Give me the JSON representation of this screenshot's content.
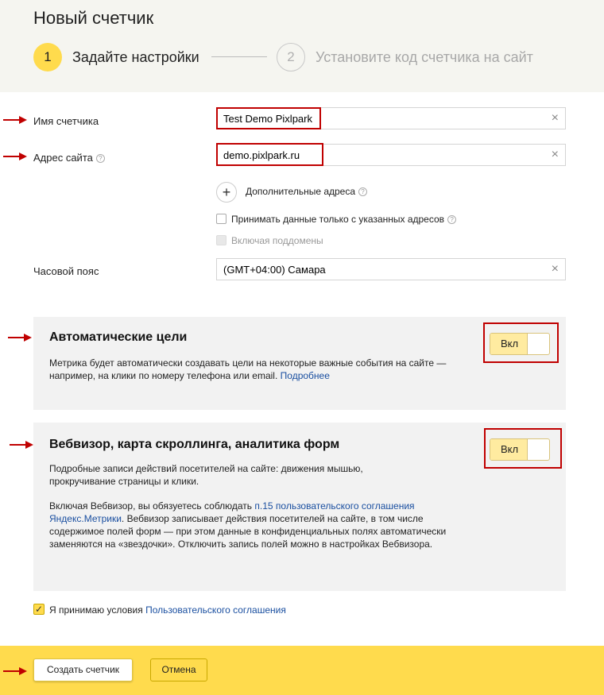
{
  "header": {
    "title": "Новый счетчик",
    "step1_number": "1",
    "step1_label": "Задайте настройки",
    "step2_number": "2",
    "step2_label": "Установите код счетчика на сайт"
  },
  "form": {
    "counter_name_label": "Имя счетчика",
    "counter_name_value": "Test Demo Pixlpark",
    "site_address_label": "Адрес сайта",
    "site_address_value": "demo.pixlpark.ru",
    "help_glyph": "?",
    "clear_glyph": "×",
    "plus_glyph": "+",
    "additional_addresses_label": "Дополнительные адреса",
    "accept_only_label": "Принимать данные только с указанных адресов",
    "include_subdomains_label": "Включая поддомены",
    "timezone_label": "Часовой пояс",
    "timezone_value": "(GMT+04:00) Самара"
  },
  "auto_goals": {
    "title": "Автоматические цели",
    "text": "Метрика будет автоматически создавать цели на некоторые важные события на сайте — например, на клики по номеру телефона или email.",
    "link": "Подробнее",
    "toggle_label": "Вкл"
  },
  "webvisor": {
    "title": "Вебвизор, карта скроллинга, аналитика форм",
    "text1": "Подробные записи действий посетителей на сайте: движения мышью, прокручивание страницы и клики.",
    "text2_before": "Включая Вебвизор, вы обязуетесь соблюдать ",
    "text2_link": "п.15 пользовательского соглашения Яндекс.Метрики",
    "text2_after": ". Вебвизор записывает действия посетителей на сайте, в том числе содержимое полей форм — при этом данные в конфиденциальных полях автоматически заменяются на «звездочки». Отключить запись полей можно в настройках Вебвизора.",
    "toggle_label": "Вкл"
  },
  "agreement": {
    "check_glyph": "✓",
    "label": "Я принимаю условия ",
    "link": "Пользовательского соглашения"
  },
  "footer": {
    "create_label": "Создать счетчик",
    "cancel_label": "Отмена"
  },
  "colors": {
    "accent_yellow": "#ffdb4d",
    "annotation_red": "#c00000",
    "link_blue": "#1a4fa0"
  }
}
